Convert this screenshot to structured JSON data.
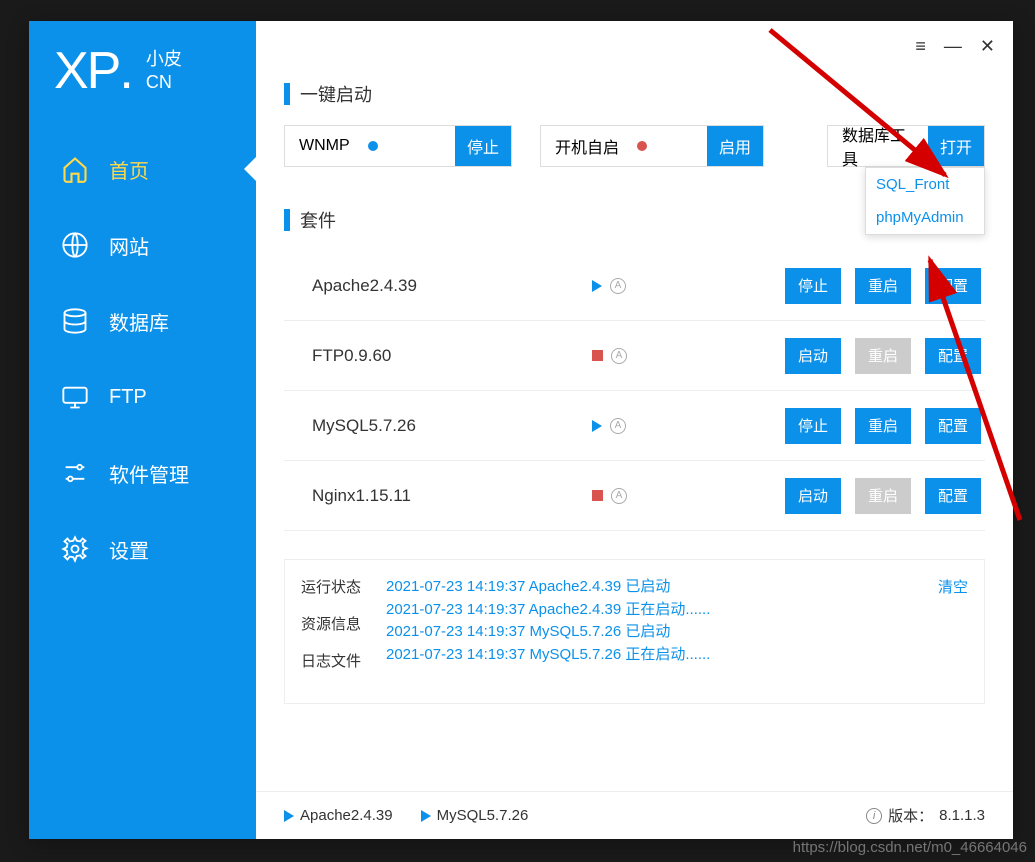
{
  "logo": {
    "xp": "XP",
    "dot": ".",
    "cn_top": "小皮",
    "cn_bottom": "CN"
  },
  "nav": [
    {
      "label": "首页",
      "icon": "home"
    },
    {
      "label": "网站",
      "icon": "globe"
    },
    {
      "label": "数据库",
      "icon": "database"
    },
    {
      "label": "FTP",
      "icon": "monitor"
    },
    {
      "label": "软件管理",
      "icon": "sliders"
    },
    {
      "label": "设置",
      "icon": "gear"
    }
  ],
  "sections": {
    "quickstart": "一键启动",
    "suite": "套件"
  },
  "quick": {
    "wnmp_label": "WNMP",
    "wnmp_btn": "停止",
    "boot_label": "开机自启",
    "boot_btn": "启用",
    "db_label": "数据库工具",
    "db_btn": "打开",
    "dropdown": [
      "SQL_Front",
      "phpMyAdmin"
    ]
  },
  "suites": [
    {
      "name": "Apache2.4.39",
      "running": true,
      "btns": [
        "停止",
        "重启",
        "配置"
      ],
      "disabled": null
    },
    {
      "name": "FTP0.9.60",
      "running": false,
      "btns": [
        "启动",
        "重启",
        "配置"
      ],
      "disabled": 1
    },
    {
      "name": "MySQL5.7.26",
      "running": true,
      "btns": [
        "停止",
        "重启",
        "配置"
      ],
      "disabled": null
    },
    {
      "name": "Nginx1.15.11",
      "running": false,
      "btns": [
        "启动",
        "重启",
        "配置"
      ],
      "disabled": 1
    }
  ],
  "log": {
    "tabs": [
      "运行状态",
      "资源信息",
      "日志文件"
    ],
    "lines": [
      "2021-07-23 14:19:37 Apache2.4.39 已启动",
      "2021-07-23 14:19:37 Apache2.4.39 正在启动......",
      "2021-07-23 14:19:37 MySQL5.7.26 已启动",
      "2021-07-23 14:19:37 MySQL5.7.26 正在启动......"
    ],
    "clear": "清空"
  },
  "statusbar": {
    "items": [
      "Apache2.4.39",
      "MySQL5.7.26"
    ],
    "version_label": "版本：",
    "version": "8.1.1.3"
  },
  "watermark": "https://blog.csdn.net/m0_46664046"
}
